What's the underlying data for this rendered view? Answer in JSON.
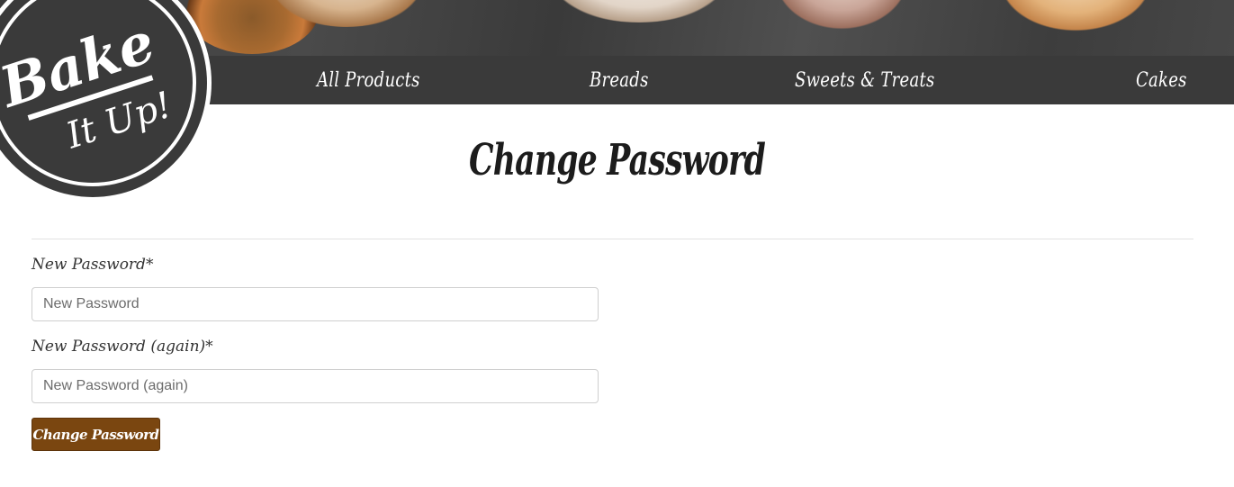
{
  "brand": {
    "logo_line1": "Bake",
    "logo_line2": "It Up!"
  },
  "nav": {
    "items": [
      {
        "label": "All Products"
      },
      {
        "label": "Breads"
      },
      {
        "label": "Sweets & Treats"
      },
      {
        "label": "Cakes"
      }
    ]
  },
  "page": {
    "title": "Change Password"
  },
  "form": {
    "password1": {
      "label": "New Password*",
      "placeholder": "New Password",
      "value": ""
    },
    "password2": {
      "label": "New Password (again)*",
      "placeholder": "New Password (again)",
      "value": ""
    },
    "submit_label": "Change Password"
  },
  "colors": {
    "nav_bg": "#3a3a3a",
    "button_bg": "#7a4610",
    "title_text": "#1c1c1c"
  }
}
